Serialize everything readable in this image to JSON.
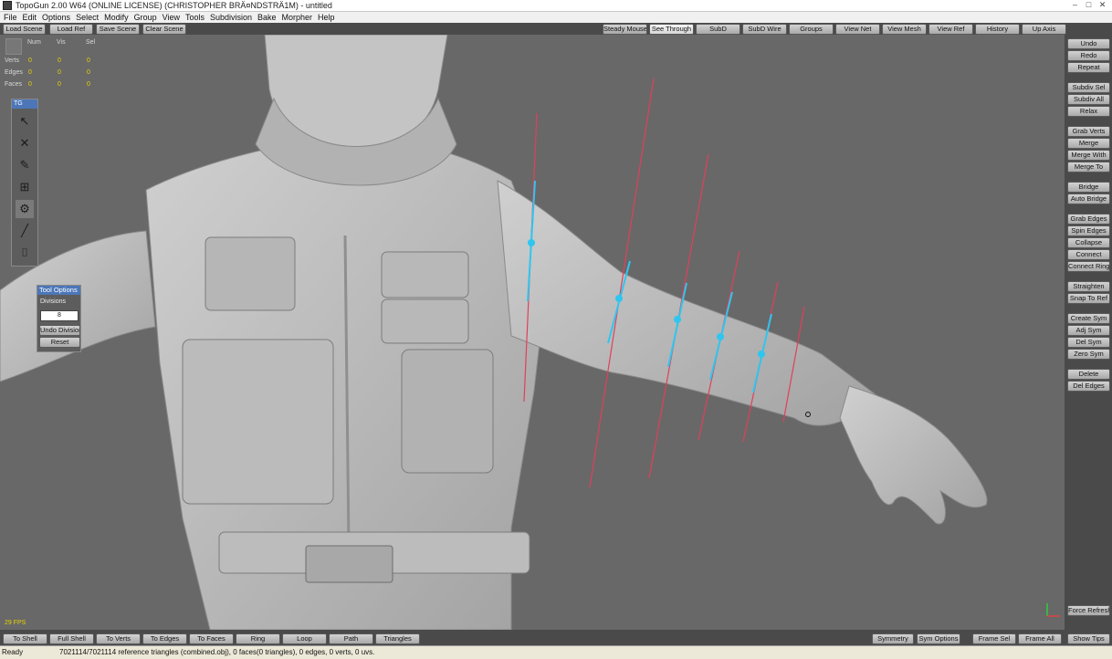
{
  "window": {
    "title": "TopoGun 2.00 W64  (ONLINE LICENSE) (CHRISTOPHER BRÄ¤NDSTRÄ1M) - untitled",
    "minimize": "–",
    "maximize": "□",
    "close": "✕"
  },
  "menu": [
    "File",
    "Edit",
    "Options",
    "Select",
    "Modify",
    "Group",
    "View",
    "Tools",
    "Subdivision",
    "Bake",
    "Morpher",
    "Help"
  ],
  "top_left_buttons": [
    "Load Scene",
    "Load Ref",
    "Save Scene",
    "Clear Scene"
  ],
  "top_right_buttons": [
    "Steady Mouse",
    "See Through",
    "SubD",
    "SubD Wire",
    "Groups",
    "View Net",
    "View Mesh",
    "View Ref",
    "History",
    "Up Axis"
  ],
  "stats": {
    "headers": [
      "Num",
      "Vis",
      "Sel"
    ],
    "rows": [
      {
        "label": "Verts",
        "values": [
          "0",
          "0",
          "0"
        ]
      },
      {
        "label": "Edges",
        "values": [
          "0",
          "0",
          "0"
        ]
      },
      {
        "label": "Faces",
        "values": [
          "0",
          "0",
          "0"
        ]
      }
    ]
  },
  "toolbox": {
    "title": "TG",
    "tools": [
      {
        "name": "select-tool-icon",
        "glyph": "↖"
      },
      {
        "name": "delete-tool-icon",
        "glyph": "✕"
      },
      {
        "name": "draw-tool-icon",
        "glyph": "✎"
      },
      {
        "name": "bridge-tool-icon",
        "glyph": "⊞"
      },
      {
        "name": "tubes-tool-icon",
        "glyph": "⚙"
      },
      {
        "name": "brush-tool-icon",
        "glyph": "╱"
      },
      {
        "name": "extrude-tool-icon",
        "glyph": "⌷"
      }
    ]
  },
  "tool_options": {
    "title": "Tool Options",
    "divisions_label": "Divisions",
    "divisions_value": "8",
    "undo_label": "Undo Division",
    "reset_label": "Reset"
  },
  "right_panel": {
    "groups": [
      [
        "Undo",
        "Redo",
        "Repeat"
      ],
      [
        "Subdiv Sel",
        "Subdiv All",
        "Relax"
      ],
      [
        "Grab Verts",
        "Merge",
        "Merge With",
        "Merge To"
      ],
      [
        "Bridge",
        "Auto Bridge"
      ],
      [
        "Grab Edges",
        "Spin Edges",
        "Collapse",
        "Connect",
        "Connect Ring"
      ],
      [
        "Straighten",
        "Snap To Ref"
      ],
      [
        "Create Sym",
        "Adj Sym",
        "Del Sym",
        "Zero Sym"
      ],
      [
        "Delete",
        "Del Edges"
      ]
    ],
    "force_refresh": "Force Refresh",
    "show_tips": "Show Tips"
  },
  "bottom_left_buttons": [
    "To Shell",
    "Full Shell",
    "To Verts",
    "To Edges",
    "To Faces",
    "Ring",
    "Loop",
    "Path",
    "Triangles"
  ],
  "bottom_right_buttons": [
    "Symmetry",
    "Sym Options",
    "Frame Sel",
    "Frame All"
  ],
  "fps": "29 FPS",
  "status": {
    "state": "Ready",
    "message": "7021114/7021114 reference triangles (combined.obj), 0 faces(0 triangles), 0 edges, 0 verts, 0 uvs."
  },
  "colors": {
    "viewport_bg": "#686868",
    "model": "#bdbdbd",
    "guide_red": "#e0405a",
    "guide_cyan": "#2ec6f0",
    "stat_value": "#e6d200",
    "panel_bg": "#4a4a4a"
  }
}
